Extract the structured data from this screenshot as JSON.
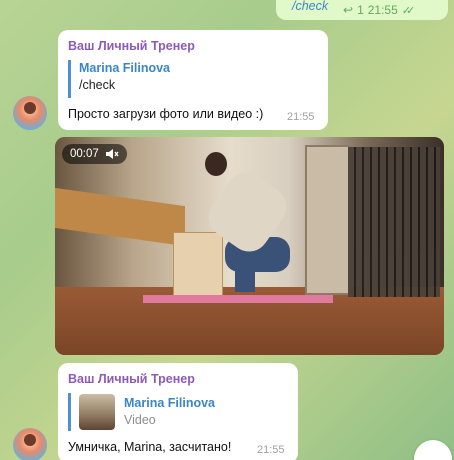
{
  "outgoing": {
    "text": "/check",
    "reply_count": "1",
    "time": "21:55"
  },
  "msg1": {
    "sender": "Ваш Личный Тренер",
    "quote_name": "Marina Filinova",
    "quote_text": "/check",
    "text": "Просто загрузи фото или видео :)",
    "time": "21:55"
  },
  "video": {
    "duration": "00:07"
  },
  "msg3": {
    "sender": "Ваш Личный Тренер",
    "quote_name": "Marina Filinova",
    "quote_text": "Video",
    "text": "Умничка, Marina, засчитано!",
    "time": "21:55"
  },
  "icons": {
    "reply": "reply-icon",
    "read": "double-check-icon",
    "mute": "muted-speaker-icon"
  }
}
